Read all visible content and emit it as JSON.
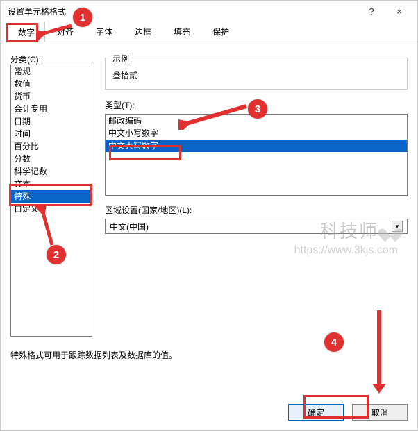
{
  "title": "设置单元格格式",
  "help_glyph": "?",
  "close_glyph": "×",
  "tabs": [
    "数字",
    "对齐",
    "字体",
    "边框",
    "填充",
    "保护"
  ],
  "active_tab": 0,
  "category_label": "分类(C):",
  "categories": [
    "常规",
    "数值",
    "货币",
    "会计专用",
    "日期",
    "时间",
    "百分比",
    "分数",
    "科学记数",
    "文本",
    "特殊",
    "自定义"
  ],
  "category_selected": 10,
  "sample_label": "示例",
  "sample_value": "叁拾贰",
  "type_label": "类型(T):",
  "types": [
    "邮政编码",
    "中文小写数字",
    "中文大写数字"
  ],
  "type_selected": 2,
  "locale_label": "区域设置(国家/地区)(L):",
  "locale_value": "中文(中国)",
  "description": "特殊格式可用于跟踪数据列表及数据库的值。",
  "ok_label": "确定",
  "cancel_label": "取消",
  "watermark": {
    "brand": "科技师",
    "url": "https://www.3kjs.com"
  },
  "annotations": {
    "b1": "1",
    "b2": "2",
    "b3": "3",
    "b4": "4"
  }
}
